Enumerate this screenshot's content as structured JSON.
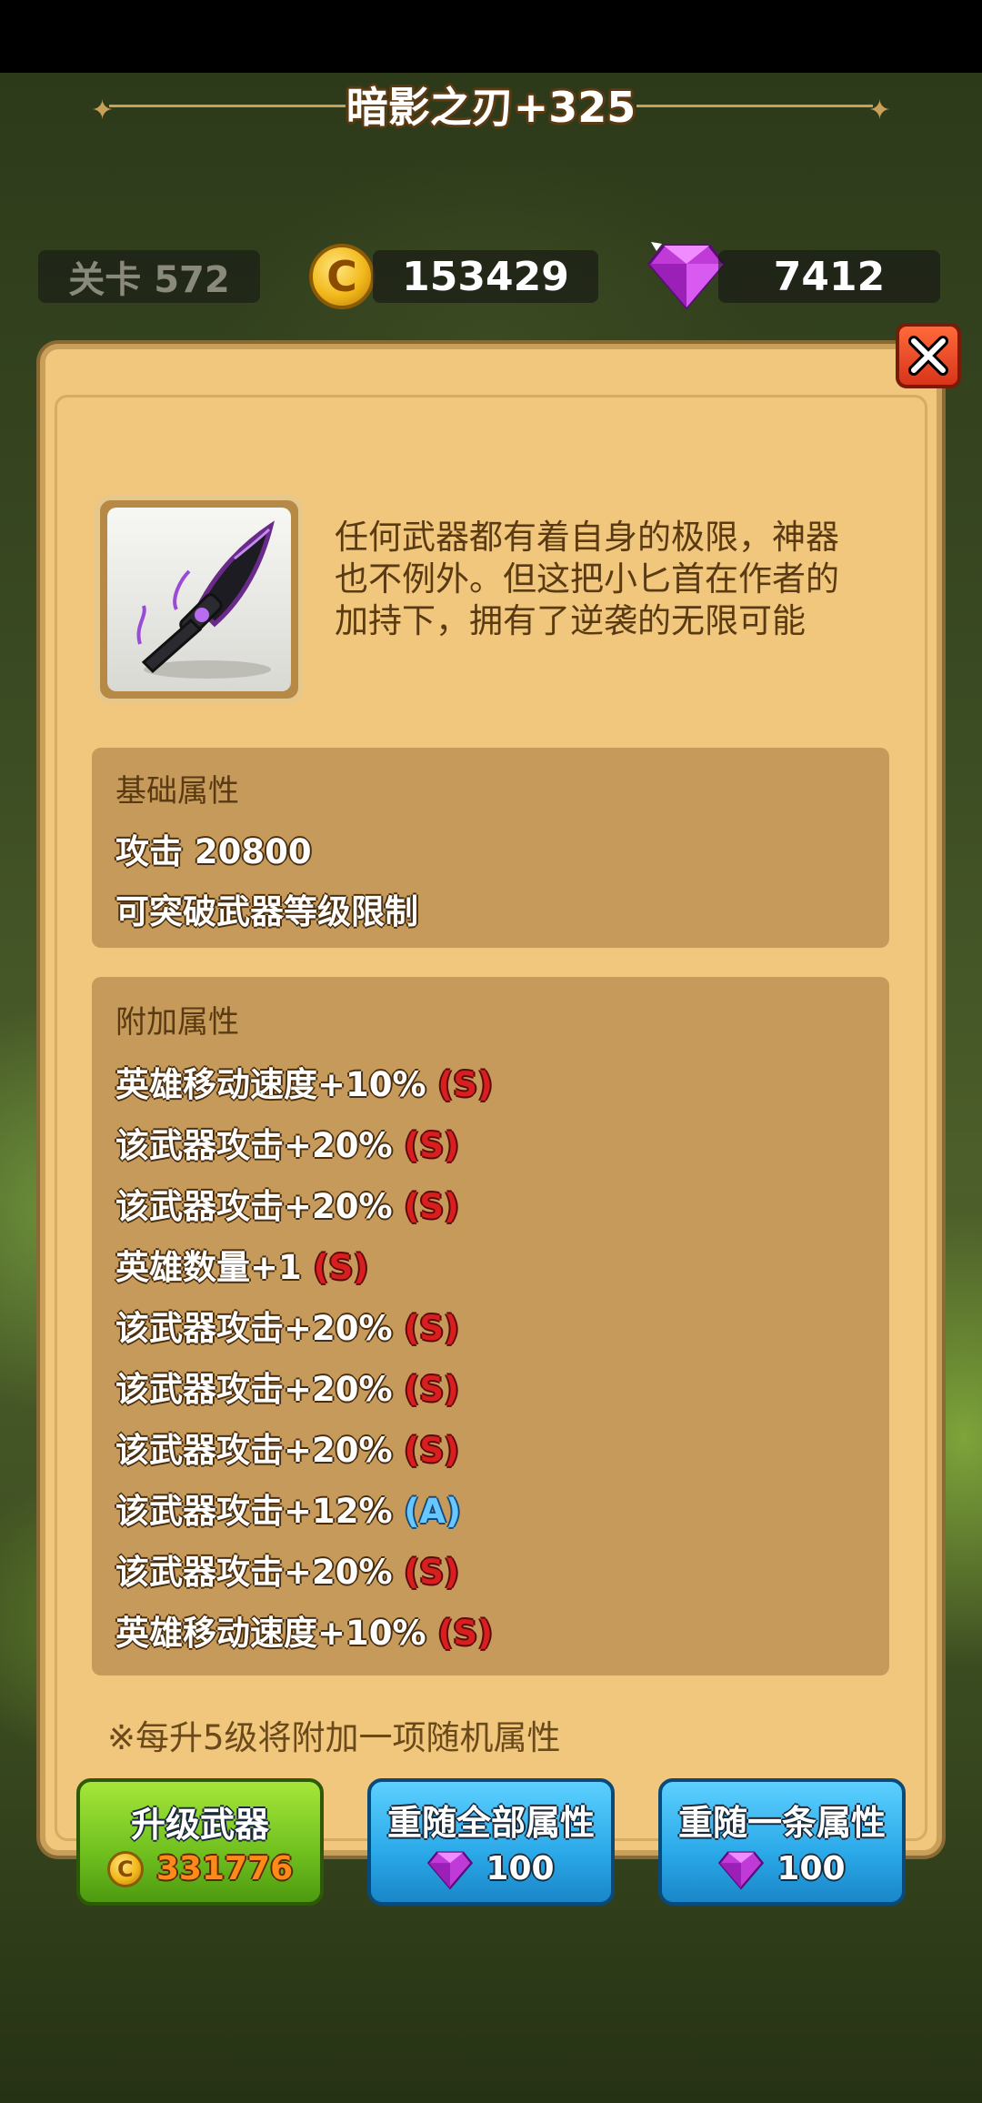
{
  "hud": {
    "level_label": "关卡 572",
    "coins": "153429",
    "gems": "7412"
  },
  "item": {
    "title": "暗影之刃+325",
    "description_lines": [
      "任何武器都有着自身的极限，神器",
      "也不例外。但这把小匕首在作者的",
      "加持下，拥有了逆袭的无限可能"
    ]
  },
  "base_attributes": {
    "title": "基础属性",
    "lines": [
      "攻击 20800",
      "可突破武器等级限制"
    ]
  },
  "extra_attributes": {
    "title": "附加属性",
    "lines": [
      {
        "text": "英雄移动速度+10%",
        "grade": "S"
      },
      {
        "text": "该武器攻击+20%",
        "grade": "S"
      },
      {
        "text": "该武器攻击+20%",
        "grade": "S"
      },
      {
        "text": "英雄数量+1",
        "grade": "S"
      },
      {
        "text": "该武器攻击+20%",
        "grade": "S"
      },
      {
        "text": "该武器攻击+20%",
        "grade": "S"
      },
      {
        "text": "该武器攻击+20%",
        "grade": "S"
      },
      {
        "text": "该武器攻击+12%",
        "grade": "A"
      },
      {
        "text": "该武器攻击+20%",
        "grade": "S"
      },
      {
        "text": "英雄移动速度+10%",
        "grade": "S"
      }
    ]
  },
  "note": "※每升5级将附加一项随机属性",
  "buttons": {
    "upgrade": {
      "label": "升级武器",
      "cost": "331776"
    },
    "reroll_all": {
      "label": "重随全部属性",
      "cost": "100"
    },
    "reroll_one": {
      "label": "重随一条属性",
      "cost": "100"
    }
  },
  "icons": {
    "coin": "C"
  },
  "colors": {
    "grade_s": "#d81e1e",
    "grade_a": "#66c8ff",
    "panel": "#f0c77c"
  }
}
